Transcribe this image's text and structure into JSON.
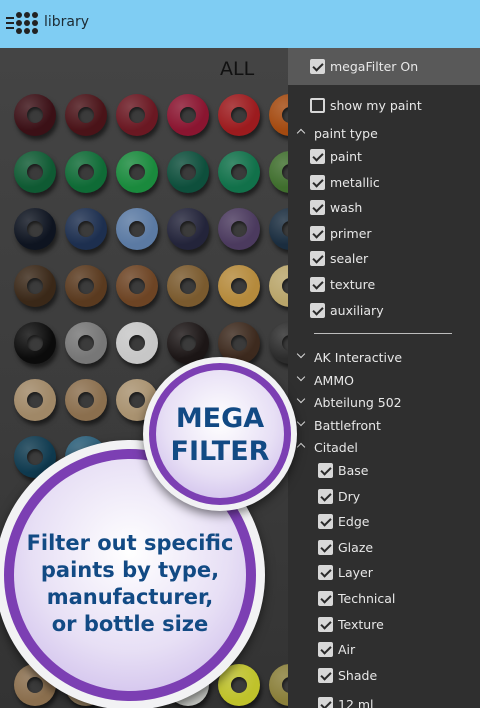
{
  "app": {
    "title": "library"
  },
  "grid": {
    "heading": "ALL",
    "rows": [
      [
        "#3b1016",
        "#4a1318",
        "#6a1822",
        "#8a1530",
        "#9c1b1e",
        "#a44a10"
      ],
      [
        "#0f5a33",
        "#0f6b36",
        "#1a8a3d",
        "#0e4f3c",
        "#11714a",
        "#3f6e2d"
      ],
      [
        "#0e1420",
        "#1d2f4f",
        "#5b7aa3",
        "#23243a",
        "#4b3a5e",
        "#1a2d3f"
      ],
      [
        "#3a2818",
        "#5a3a1f",
        "#6d4424",
        "#7a5a2e",
        "#b58a3c",
        "#b9a56a"
      ],
      [
        "#0b0b0b",
        "#777777",
        "#c7c7c7",
        "#1c1616",
        "#3d2a1e",
        "#2c2c2c"
      ],
      [
        "#a08867",
        "#8b6f4e",
        "#a99270",
        "",
        "",
        ""
      ],
      [
        "#0f3a4f",
        "#2a5e79",
        "",
        "",
        "",
        ""
      ],
      [
        "",
        "",
        "",
        "",
        "",
        ""
      ],
      [
        "",
        "",
        "",
        "",
        "#3f8a8f",
        ""
      ],
      [
        "",
        "",
        "",
        "",
        "",
        ""
      ],
      [
        "#8b6f4e",
        "#a08867",
        "#5a4a3a",
        "#c7c9c4",
        "#bfc22b",
        "#8a7f3a"
      ]
    ]
  },
  "promo": {
    "mega_line1": "MEGA",
    "mega_line2": "FILTER",
    "line1": "Filter out specific",
    "line2": "paints by type,",
    "line3": "manufacturer,",
    "line4": "or bottle size"
  },
  "panel": {
    "mega_filter": {
      "label": "megaFilter On",
      "checked": true
    },
    "show_my_paint": {
      "label": "show my paint",
      "checked": false
    },
    "paint_type": {
      "label": "paint type",
      "items": [
        {
          "label": "paint",
          "checked": true
        },
        {
          "label": "metallic",
          "checked": true
        },
        {
          "label": "wash",
          "checked": true
        },
        {
          "label": "primer",
          "checked": true
        },
        {
          "label": "sealer",
          "checked": true
        },
        {
          "label": "texture",
          "checked": true
        },
        {
          "label": "auxiliary",
          "checked": true
        }
      ]
    },
    "manufacturers": [
      {
        "label": "AK Interactive",
        "expanded": false
      },
      {
        "label": "AMMO",
        "expanded": false
      },
      {
        "label": "Abteilung 502",
        "expanded": false
      },
      {
        "label": "Battlefront",
        "expanded": false
      },
      {
        "label": "Citadel",
        "expanded": true
      }
    ],
    "citadel_items": [
      {
        "label": "Base",
        "checked": true
      },
      {
        "label": "Dry",
        "checked": true
      },
      {
        "label": "Edge",
        "checked": true
      },
      {
        "label": "Glaze",
        "checked": true
      },
      {
        "label": "Layer",
        "checked": true
      },
      {
        "label": "Technical",
        "checked": true
      },
      {
        "label": "Texture",
        "checked": true
      },
      {
        "label": "Air",
        "checked": true
      },
      {
        "label": "Shade",
        "checked": true
      },
      {
        "label": "12 ml",
        "checked": true
      }
    ]
  }
}
